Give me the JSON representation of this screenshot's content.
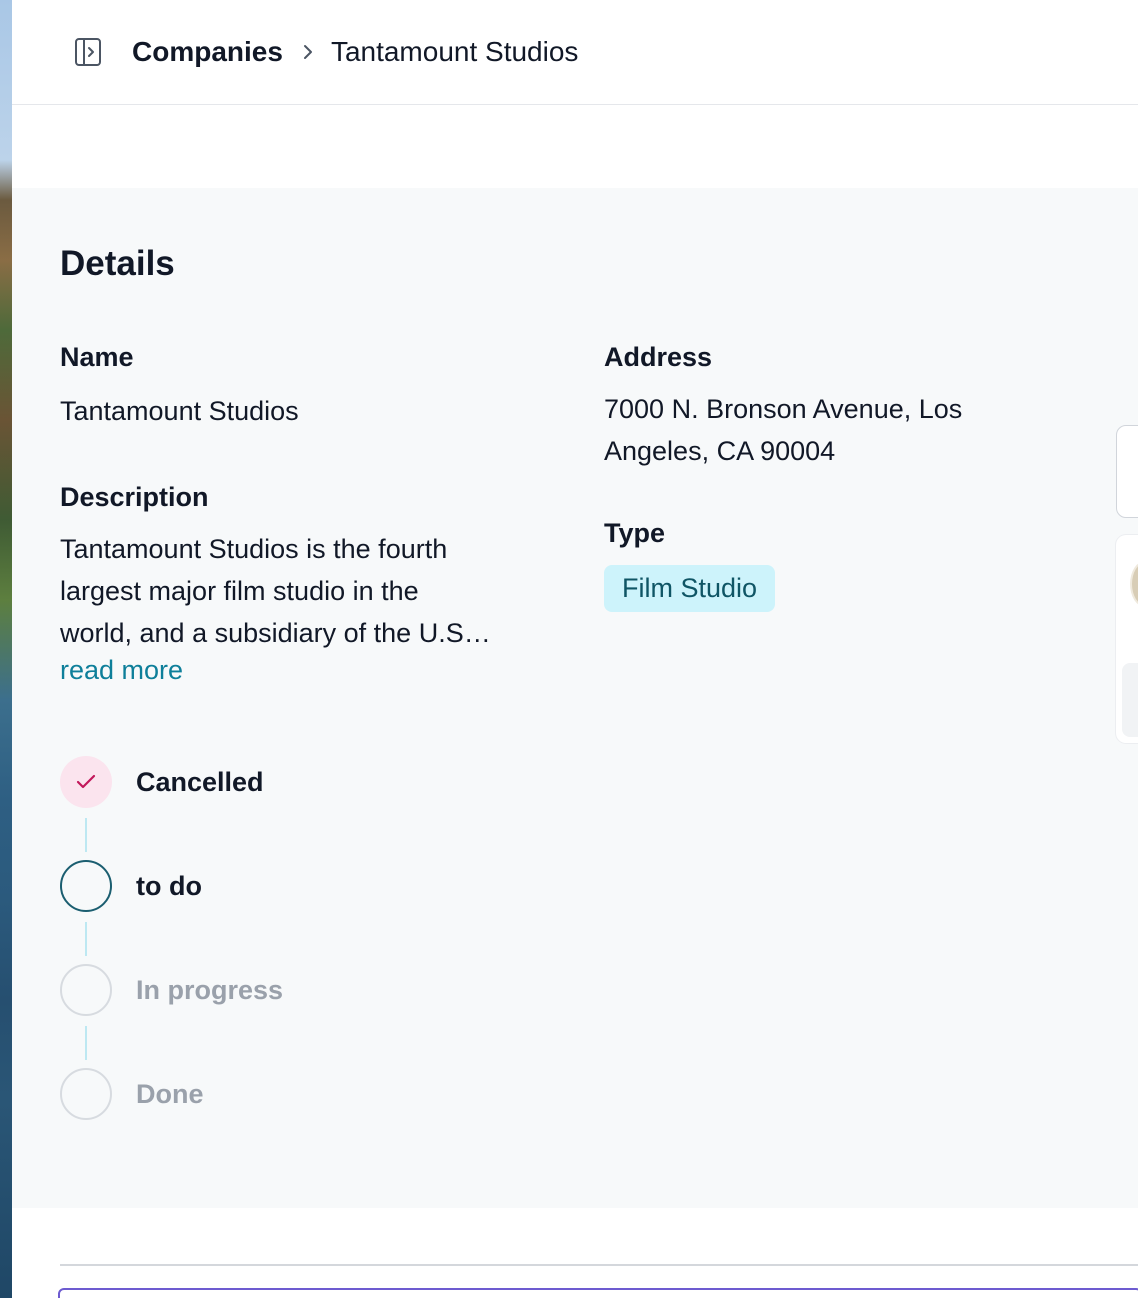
{
  "header": {
    "sidebar_toggle_icon": "sidebar-toggle-icon",
    "breadcrumb": {
      "parent": "Companies",
      "separator_icon": "chevron-right-icon",
      "current": "Tantamount Studios"
    }
  },
  "details": {
    "title": "Details",
    "name": {
      "label": "Name",
      "value": "Tantamount Studios"
    },
    "description": {
      "label": "Description",
      "lines": [
        "Tantamount Studios is the fourth",
        "largest major film studio in the",
        "world, and a subsidiary of the U.S…"
      ],
      "read_more": "read more"
    },
    "address": {
      "label": "Address",
      "lines": [
        "7000 N. Bronson Avenue, Los",
        "Angeles, CA 90004"
      ]
    },
    "type": {
      "label": "Type",
      "value": "Film Studio"
    }
  },
  "status_steps": [
    {
      "label": "Cancelled",
      "state": "completed"
    },
    {
      "label": "to do",
      "state": "current"
    },
    {
      "label": "In progress",
      "state": "upcoming"
    },
    {
      "label": "Done",
      "state": "upcoming"
    }
  ],
  "colors": {
    "accent": "#0e7f9a",
    "badge_bg": "#cdf3fb",
    "badge_text": "#0f5565",
    "check": "#c2185b",
    "current_ring": "#1b5e70",
    "panel_bg": "#f7f9fa",
    "focus_border": "#6d5bd0"
  }
}
